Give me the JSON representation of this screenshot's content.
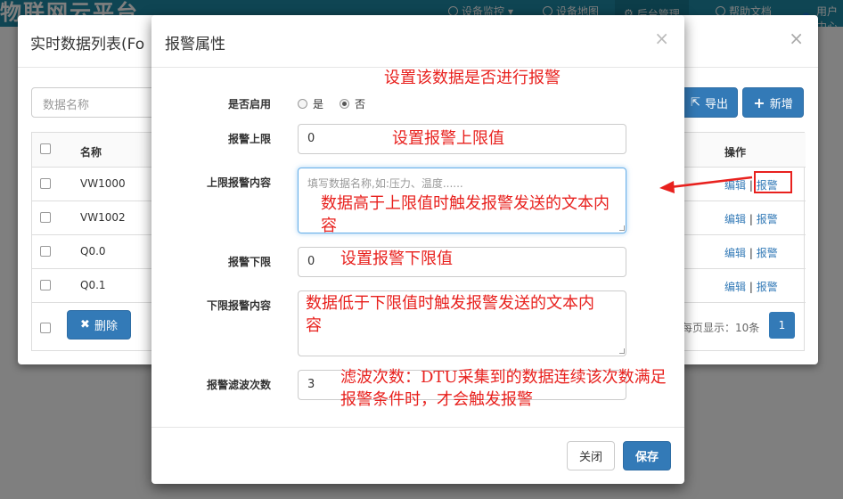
{
  "navbar": {
    "brand": "物联网云平台",
    "items": [
      "设备监控",
      "设备地图",
      "后台管理",
      "帮助文档",
      "用户中心"
    ]
  },
  "list_modal": {
    "title": "实时数据列表(Fo",
    "search_placeholder": "数据名称",
    "export_label": "导出",
    "add_label": "新增",
    "delete_label": "删除",
    "columns": {
      "name": "名称",
      "operation": "操作"
    },
    "rows": [
      {
        "name": "VW1000",
        "edit": "编辑",
        "alarm": "报警"
      },
      {
        "name": "VW1002",
        "edit": "编辑",
        "alarm": "报警"
      },
      {
        "name": "Q0.0",
        "edit": "编辑",
        "alarm": "报警"
      },
      {
        "name": "Q0.1",
        "edit": "编辑",
        "alarm": "报警"
      }
    ],
    "page_size_text": "每页显示：10条",
    "current_page": "1",
    "sep": "|"
  },
  "alarm_modal": {
    "title": "报警属性",
    "enable_label": "是否启用",
    "radio_yes": "是",
    "radio_no": "否",
    "upper_limit_label": "报警上限",
    "upper_limit_value": "0",
    "upper_content_label": "上限报警内容",
    "upper_content_placeholder": "填写数据名称,如:压力、温度......",
    "lower_limit_label": "报警下限",
    "lower_limit_value": "0",
    "lower_content_label": "下限报警内容",
    "filter_label": "报警滤波次数",
    "filter_value": "3",
    "close_label": "关闭",
    "save_label": "保存"
  },
  "annotations": {
    "enable": "设置该数据是否进行报警",
    "upper_limit": "设置报警上限值",
    "upper_content": "数据高于上限值时触发报警发送的文本内容",
    "lower_limit": "设置报警下限值",
    "lower_content": "数据低于下限值时触发报警发送的文本内容",
    "filter": "滤波次数：DTU采集到的数据连续该次数满足报警条件时，才会触发报警"
  },
  "colors": {
    "navbar": "#1f8aa6",
    "primary": "#337ab7",
    "annotation": "#e8211e"
  }
}
